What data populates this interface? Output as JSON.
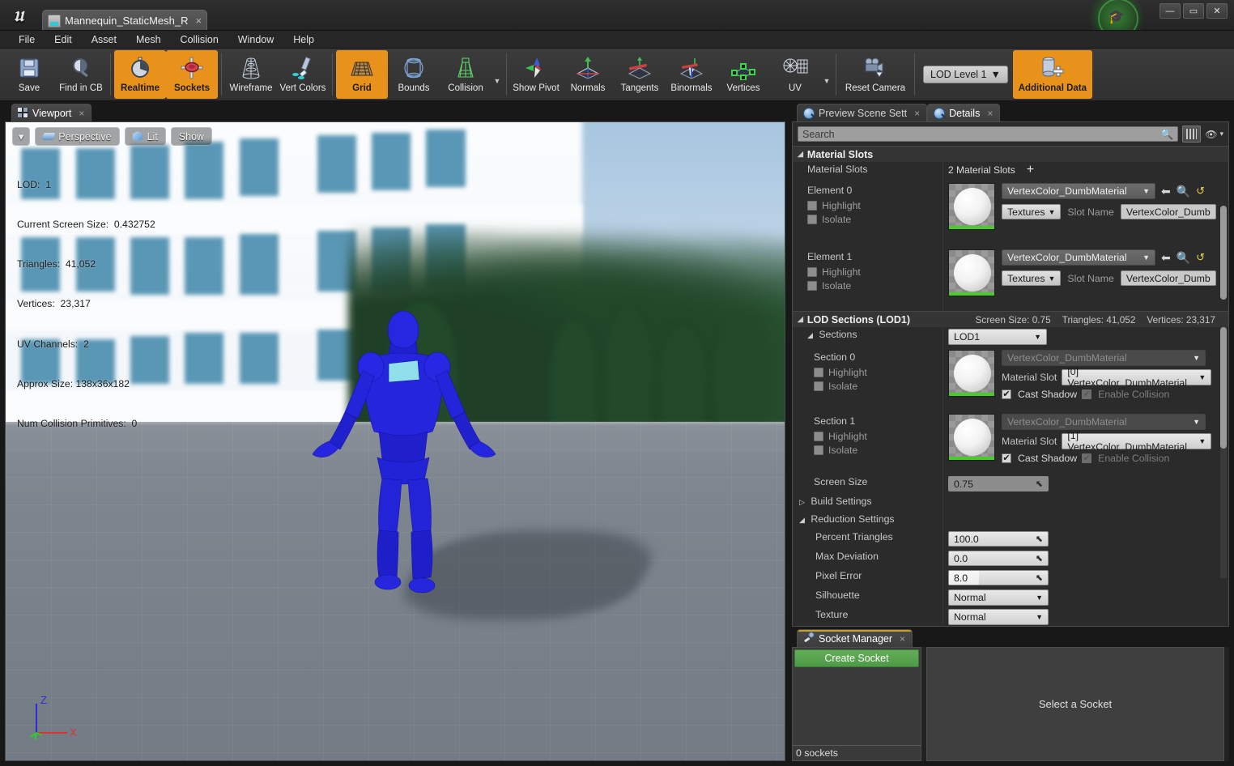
{
  "window": {
    "app_logo": "unreal-engine-logo",
    "asset_tab": "Mannequin_StaticMesh_R",
    "tab_close": "×",
    "minimize": "—",
    "maximize": "▭",
    "close": "✕",
    "help_icon": "graduation-cap-icon"
  },
  "menubar": {
    "items": [
      "File",
      "Edit",
      "Asset",
      "Mesh",
      "Collision",
      "Window",
      "Help"
    ]
  },
  "toolbar": {
    "buttons": [
      {
        "label": "Save",
        "icon": "floppy-disk-icon",
        "active": false
      },
      {
        "label": "Find in CB",
        "icon": "magnifier-icon",
        "active": false
      },
      {
        "label": "Realtime",
        "icon": "stopwatch-icon",
        "active": true
      },
      {
        "label": "Sockets",
        "icon": "socket-icon",
        "active": true
      },
      {
        "label": "Wireframe",
        "icon": "wireframe-icon",
        "active": false
      },
      {
        "label": "Vert Colors",
        "icon": "paintbrush-icon",
        "active": false
      },
      {
        "label": "Grid",
        "icon": "grid-icon",
        "active": true
      },
      {
        "label": "Bounds",
        "icon": "bounds-icon",
        "active": false
      },
      {
        "label": "Collision",
        "icon": "collision-icon",
        "active": false
      },
      {
        "label": "Show Pivot",
        "icon": "pivot-icon",
        "active": false
      },
      {
        "label": "Normals",
        "icon": "normals-icon",
        "active": false
      },
      {
        "label": "Tangents",
        "icon": "tangents-icon",
        "active": false
      },
      {
        "label": "Binormals",
        "icon": "binormals-icon",
        "active": false
      },
      {
        "label": "Vertices",
        "icon": "vertices-icon",
        "active": false
      },
      {
        "label": "UV",
        "icon": "uv-icon",
        "active": false
      },
      {
        "label": "Reset Camera",
        "icon": "camera-icon",
        "active": false
      },
      {
        "label": "Additional Data",
        "icon": "additional-data-icon",
        "active": true
      }
    ],
    "lod_level": "LOD Level 1"
  },
  "viewport": {
    "tab_label": "Viewport",
    "tab_close": "×",
    "dropdown_caret": "▾",
    "view_mode": "Perspective",
    "lighting_mode": "Lit",
    "show_menu": "Show",
    "stats": {
      "lod": "LOD:  1",
      "screen_size": "Current Screen Size:  0.432752",
      "triangles": "Triangles:  41,052",
      "vertices": "Vertices:  23,317",
      "uv_channels": "UV Channels:  2",
      "approx_size": "Approx Size: 138x36x182",
      "collision_primitives": "Num Collision Primitives:  0"
    },
    "axis": {
      "z": "Z",
      "x": "X"
    }
  },
  "details": {
    "tabs": [
      {
        "label": "Preview Scene Sett",
        "icon": "info-icon",
        "active": false,
        "close": "×"
      },
      {
        "label": "Details",
        "icon": "info-icon",
        "active": true,
        "close": "×"
      }
    ],
    "search_placeholder": "Search",
    "search_icon": "search-icon",
    "grid_view_icon": "grid-view-icon",
    "visibility_icon": "eye-icon",
    "visibility_caret": "▾",
    "material_slots": {
      "header": "Material Slots",
      "label": "Material Slots",
      "count_text": "2 Material Slots",
      "add_icon": "+",
      "elements": [
        {
          "name": "Element 0",
          "highlight": "Highlight",
          "isolate": "Isolate",
          "material": "VertexColor_DumbMaterial",
          "textures_button": "Textures",
          "slot_name_label": "Slot Name",
          "slot_name_value": "VertexColor_Dumb"
        },
        {
          "name": "Element 1",
          "highlight": "Highlight",
          "isolate": "Isolate",
          "material": "VertexColor_DumbMaterial",
          "textures_button": "Textures",
          "slot_name_label": "Slot Name",
          "slot_name_value": "VertexColor_Dumb"
        }
      ]
    },
    "lod_sections": {
      "header": "LOD Sections (LOD1)",
      "screen_size_stat": "Screen Size: 0.75",
      "triangles_stat": "Triangles: 41,052",
      "vertices_stat": "Vertices: 23,317",
      "sections_label": "Sections",
      "lod_dropdown": "LOD1",
      "sections": [
        {
          "name": "Section 0",
          "highlight": "Highlight",
          "isolate": "Isolate",
          "material": "VertexColor_DumbMaterial",
          "material_slot_label": "Material Slot",
          "material_slot_value": "[0] VertexColor_DumbMaterial",
          "cast_shadow": "Cast Shadow",
          "cast_shadow_on": true,
          "enable_collision": "Enable Collision",
          "enable_collision_on": true
        },
        {
          "name": "Section 1",
          "highlight": "Highlight",
          "isolate": "Isolate",
          "material": "VertexColor_DumbMaterial",
          "material_slot_label": "Material Slot",
          "material_slot_value": "[1] VertexColor_DumbMaterial",
          "cast_shadow": "Cast Shadow",
          "cast_shadow_on": true,
          "enable_collision": "Enable Collision",
          "enable_collision_on": true
        }
      ],
      "screen_size_label": "Screen Size",
      "screen_size_value": "0.75",
      "build_settings": "Build Settings",
      "reduction_settings": "Reduction Settings",
      "reduction": [
        {
          "label": "Percent Triangles",
          "value": "100.0",
          "type": "number"
        },
        {
          "label": "Max Deviation",
          "value": "0.0",
          "type": "number"
        },
        {
          "label": "Pixel Error",
          "value": "8.0",
          "type": "number"
        },
        {
          "label": "Silhouette",
          "value": "Normal",
          "type": "combo"
        },
        {
          "label": "Texture",
          "value": "Normal",
          "type": "combo"
        }
      ]
    }
  },
  "socket_manager": {
    "tab_label": "Socket Manager",
    "tab_icon": "socket-tool-icon",
    "tab_close": "×",
    "create_button": "Create Socket",
    "socket_count": "0 sockets",
    "empty_message": "Select a Socket"
  },
  "colors": {
    "accent_orange": "#e8921c",
    "green_button": "#4e9a46",
    "panel_bg": "#2b2b2b",
    "mesh_blue": "#2222dd"
  }
}
